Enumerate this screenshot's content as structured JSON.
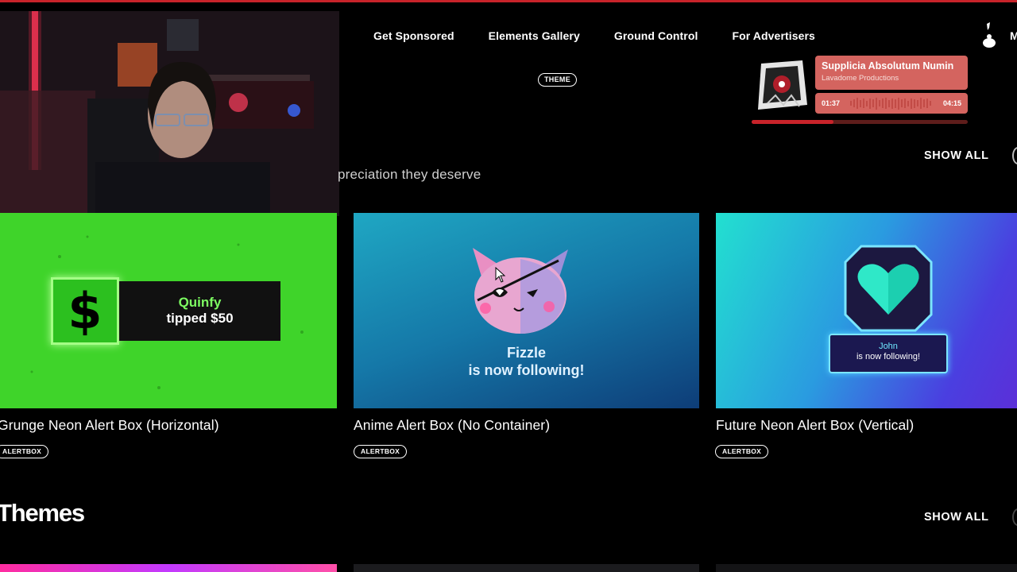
{
  "nav": {
    "items": [
      "Get Sponsored",
      "Elements Gallery",
      "Ground Control",
      "For Advertisers"
    ],
    "right_letter": "M"
  },
  "theme_pill": "THEME",
  "player": {
    "title": "Supplicia Absolutum Numin",
    "artist": "Lavadome Productions",
    "time_current": "01:37",
    "time_total": "04:15",
    "progress": 0.38
  },
  "alerts_section": {
    "subtitle": "preciation they deserve",
    "show_all": "SHOW ALL"
  },
  "cards": [
    {
      "title": "Grunge Neon Alert Box (Horizontal)",
      "tag": "ALERTBOX",
      "preview": {
        "symbol": "$",
        "name": "Quinfy",
        "message": "tipped $50"
      }
    },
    {
      "title": "Anime Alert Box (No Container)",
      "tag": "ALERTBOX",
      "preview": {
        "name": "Fizzle",
        "message": "is now following!"
      }
    },
    {
      "title": "Future Neon Alert Box (Vertical)",
      "tag": "ALERTBOX",
      "preview": {
        "name": "John",
        "message": "is now following!"
      }
    }
  ],
  "themes_section": {
    "title": "Themes",
    "show_all": "SHOW ALL"
  },
  "colors": {
    "accent_red": "#c8232a",
    "player_bg": "#d4645f",
    "alert_green": "#3fd42a"
  }
}
